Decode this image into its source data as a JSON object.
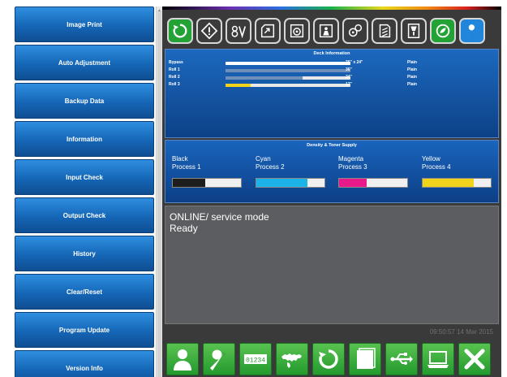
{
  "sidebar": {
    "items": [
      {
        "label": "Image Print"
      },
      {
        "label": "Auto Adjustment"
      },
      {
        "label": "Backup Data"
      },
      {
        "label": "Information"
      },
      {
        "label": "Input Check"
      },
      {
        "label": "Output Check"
      },
      {
        "label": "History"
      },
      {
        "label": "Clear/Reset"
      },
      {
        "label": "Program Update"
      },
      {
        "label": "Version Info"
      }
    ]
  },
  "top_icons": [
    {
      "name": "refresh-icon",
      "style": "green"
    },
    {
      "name": "warning-icon",
      "style": "dark"
    },
    {
      "name": "voltage-icon",
      "style": "dark"
    },
    {
      "name": "paper-feed-icon",
      "style": "dark"
    },
    {
      "name": "drum-icon",
      "style": "dark"
    },
    {
      "name": "toner-icon",
      "style": "dark"
    },
    {
      "name": "color-palette-icon",
      "style": "dark"
    },
    {
      "name": "paper-stack-icon",
      "style": "dark"
    },
    {
      "name": "finisher-icon",
      "style": "dark"
    },
    {
      "name": "eco-icon",
      "style": "green"
    },
    {
      "name": "wrench-icon",
      "style": "blue"
    }
  ],
  "deck_info": {
    "title": "Deck Information",
    "rows": [
      {
        "name": "Bypass",
        "size": "36\" x 24\"",
        "type": "Plain",
        "level": 1.0,
        "color": "#ffffff"
      },
      {
        "name": "Roll 1",
        "size": "36\"",
        "type": "Plain",
        "level": 1.0,
        "color": "#6e8fb9"
      },
      {
        "name": "Roll 2",
        "size": "24\"",
        "type": "Plain",
        "level": 0.62,
        "color": "#6e8fb9"
      },
      {
        "name": "Roll 3",
        "size": "17\"",
        "type": "Plain",
        "level": 0.2,
        "color": "#f2d31b"
      }
    ]
  },
  "toner": {
    "title": "Density & Toner Supply",
    "items": [
      {
        "color_name": "Black",
        "process": "Process 1",
        "level": 0.48,
        "hex": "#1e1e1e"
      },
      {
        "color_name": "Cyan",
        "process": "Process 2",
        "level": 0.75,
        "hex": "#1cb4e8"
      },
      {
        "color_name": "Magenta",
        "process": "Process 3",
        "level": 0.4,
        "hex": "#e8198b"
      },
      {
        "color_name": "Yellow",
        "process": "Process 4",
        "level": 0.75,
        "hex": "#f2d31b"
      }
    ]
  },
  "status": {
    "line1": "ONLINE/ service mode",
    "line2": "Ready"
  },
  "timestamp": "09:50:57 14 Mar 2015",
  "toolbar": {
    "counter_text": "01234",
    "buttons": [
      {
        "name": "user-icon"
      },
      {
        "name": "wrench-icon"
      },
      {
        "name": "counter-icon"
      },
      {
        "name": "world-map-icon"
      },
      {
        "name": "refresh-icon"
      },
      {
        "name": "paper-icon"
      },
      {
        "name": "usb-icon"
      },
      {
        "name": "laptop-icon"
      },
      {
        "name": "close-icon"
      }
    ]
  },
  "colors": {
    "menu_blue": "#1566b6",
    "panel_blue": "#0d4187",
    "status_gray": "#5c5d61",
    "toolbar_green": "#249a2f"
  }
}
